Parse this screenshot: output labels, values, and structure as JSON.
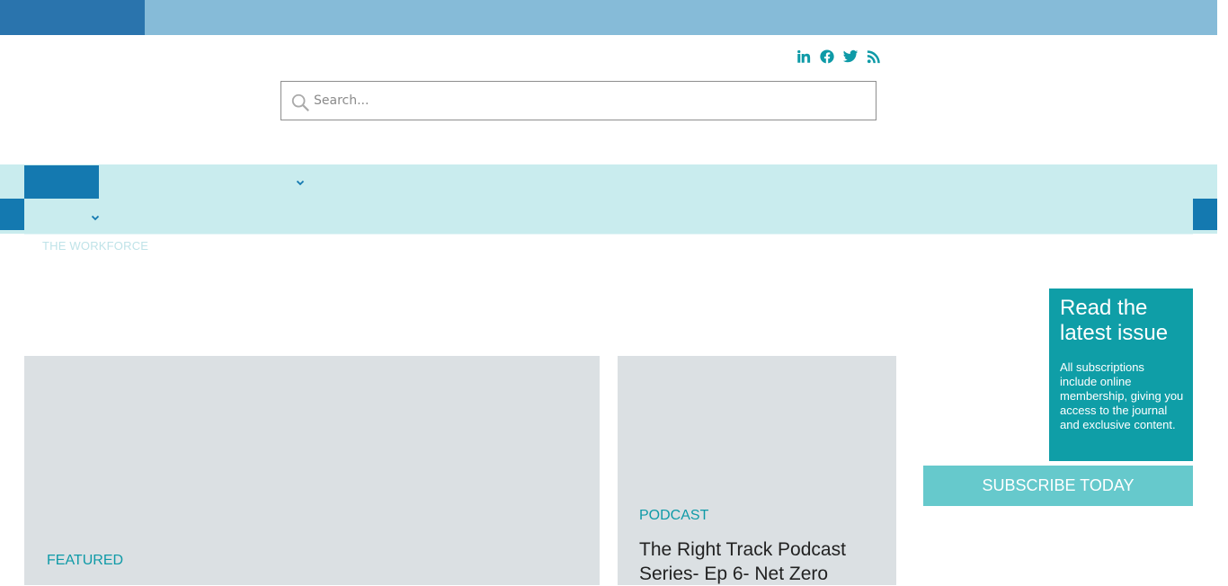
{
  "header": {
    "social_icons": [
      "linkedin-icon",
      "facebook-icon",
      "twitter-icon",
      "rss-icon"
    ],
    "search": {
      "placeholder": "Search..."
    }
  },
  "nav": {
    "partial_item": "THE WORKFORCE"
  },
  "cards": [
    {
      "category": "FEATURED",
      "title": ""
    },
    {
      "category": "PODCAST",
      "title": "The Right Track Podcast Series- Ep 6- Net Zero"
    }
  ],
  "sidebar": {
    "promo_title": "Read the latest issue",
    "promo_text": "All subscriptions include online membership, giving you access to the journal and exclusive content.",
    "subscribe_label": "SUBSCRIBE TODAY"
  },
  "colors": {
    "accent": "#0e9aa7",
    "nav_bg": "#c9ecee",
    "dark_blue": "#1479b0",
    "top_bar": "#86bbd8"
  }
}
